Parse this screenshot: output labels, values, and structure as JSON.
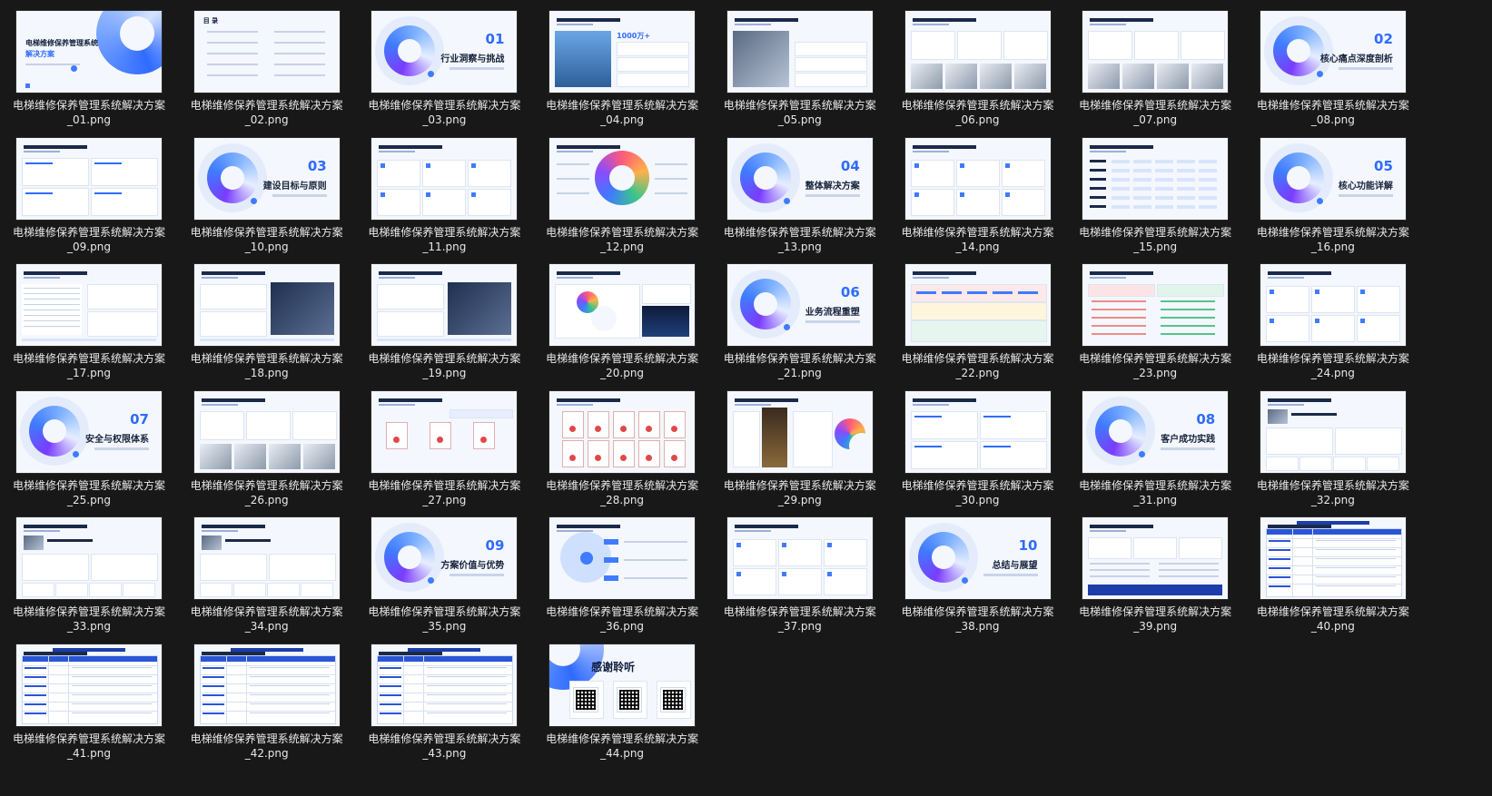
{
  "files": [
    {
      "line1": "电梯维修保养管理系统解决方案",
      "line2": "_01.png",
      "kind": "cover",
      "title": "电梯维修保养管理系统",
      "subtitle": "解决方案"
    },
    {
      "line1": "电梯维修保养管理系统解决方案",
      "line2": "_02.png",
      "kind": "toc",
      "title": "目 录"
    },
    {
      "line1": "电梯维修保养管理系统解决方案",
      "line2": "_03.png",
      "kind": "section",
      "num": "01",
      "title": "行业洞察与挑战"
    },
    {
      "line1": "电梯维修保养管理系统解决方案",
      "line2": "_04.png",
      "kind": "photo-left",
      "num": "1000万+"
    },
    {
      "line1": "电梯维修保养管理系统解决方案",
      "line2": "_05.png",
      "kind": "photo-left"
    },
    {
      "line1": "电梯维修保养管理系统解决方案",
      "line2": "_06.png",
      "kind": "photo-row"
    },
    {
      "line1": "电梯维修保养管理系统解决方案",
      "line2": "_07.png",
      "kind": "photo-row"
    },
    {
      "line1": "电梯维修保养管理系统解决方案",
      "line2": "_08.png",
      "kind": "section",
      "num": "02",
      "title": "核心痛点深度剖析"
    },
    {
      "line1": "电梯维修保养管理系统解决方案",
      "line2": "_09.png",
      "kind": "cards4"
    },
    {
      "line1": "电梯维修保养管理系统解决方案",
      "line2": "_10.png",
      "kind": "section",
      "num": "03",
      "title": "建设目标与原则"
    },
    {
      "line1": "电梯维修保养管理系统解决方案",
      "line2": "_11.png",
      "kind": "cards6"
    },
    {
      "line1": "电梯维修保养管理系统解决方案",
      "line2": "_12.png",
      "kind": "flower"
    },
    {
      "line1": "电梯维修保养管理系统解决方案",
      "line2": "_13.png",
      "kind": "section",
      "num": "04",
      "title": "整体解决方案"
    },
    {
      "line1": "电梯维修保养管理系统解决方案",
      "line2": "_14.png",
      "kind": "cards6"
    },
    {
      "line1": "电梯维修保养管理系统解决方案",
      "line2": "_15.png",
      "kind": "tags"
    },
    {
      "line1": "电梯维修保养管理系统解决方案",
      "line2": "_16.png",
      "kind": "section",
      "num": "05",
      "title": "核心功能详解"
    },
    {
      "line1": "电梯维修保养管理系统解决方案",
      "line2": "_17.png",
      "kind": "screen-left"
    },
    {
      "line1": "电梯维修保养管理系统解决方案",
      "line2": "_18.png",
      "kind": "screen-right"
    },
    {
      "line1": "电梯维修保养管理系统解决方案",
      "line2": "_19.png",
      "kind": "screen-right"
    },
    {
      "line1": "电梯维修保养管理系统解决方案",
      "line2": "_20.png",
      "kind": "dashboard"
    },
    {
      "line1": "电梯维修保养管理系统解决方案",
      "line2": "_21.png",
      "kind": "section",
      "num": "06",
      "title": "业务流程重塑"
    },
    {
      "line1": "电梯维修保养管理系统解决方案",
      "line2": "_22.png",
      "kind": "flow"
    },
    {
      "line1": "电梯维修保养管理系统解决方案",
      "line2": "_23.png",
      "kind": "compare"
    },
    {
      "line1": "电梯维修保养管理系统解决方案",
      "line2": "_24.png",
      "kind": "cards6"
    },
    {
      "line1": "电梯维修保养管理系统解决方案",
      "line2": "_25.png",
      "kind": "section",
      "num": "07",
      "title": "安全与权限体系"
    },
    {
      "line1": "电梯维修保养管理系统解决方案",
      "line2": "_26.png",
      "kind": "photo-row"
    },
    {
      "line1": "电梯维修保养管理系统解决方案",
      "line2": "_27.png",
      "kind": "certs3"
    },
    {
      "line1": "电梯维修保养管理系统解决方案",
      "line2": "_28.png",
      "kind": "certs"
    },
    {
      "line1": "电梯维修保养管理系统解决方案",
      "line2": "_29.png",
      "kind": "phone"
    },
    {
      "line1": "电梯维修保养管理系统解决方案",
      "line2": "_30.png",
      "kind": "cards4"
    },
    {
      "line1": "电梯维修保养管理系统解决方案",
      "line2": "_31.png",
      "kind": "section",
      "num": "08",
      "title": "客户成功实践"
    },
    {
      "line1": "电梯维修保养管理系统解决方案",
      "line2": "_32.png",
      "kind": "case"
    },
    {
      "line1": "电梯维修保养管理系统解决方案",
      "line2": "_33.png",
      "kind": "case"
    },
    {
      "line1": "电梯维修保养管理系统解决方案",
      "line2": "_34.png",
      "kind": "case"
    },
    {
      "line1": "电梯维修保养管理系统解决方案",
      "line2": "_35.png",
      "kind": "section",
      "num": "09",
      "title": "方案价值与优势"
    },
    {
      "line1": "电梯维修保养管理系统解决方案",
      "line2": "_36.png",
      "kind": "circle"
    },
    {
      "line1": "电梯维修保养管理系统解决方案",
      "line2": "_37.png",
      "kind": "cards6"
    },
    {
      "line1": "电梯维修保养管理系统解决方案",
      "line2": "_38.png",
      "kind": "section",
      "num": "10",
      "title": "总结与展望"
    },
    {
      "line1": "电梯维修保养管理系统解决方案",
      "line2": "_39.png",
      "kind": "summary"
    },
    {
      "line1": "电梯维修保养管理系统解决方案",
      "line2": "_40.png",
      "kind": "table"
    },
    {
      "line1": "电梯维修保养管理系统解决方案",
      "line2": "_41.png",
      "kind": "table"
    },
    {
      "line1": "电梯维修保养管理系统解决方案",
      "line2": "_42.png",
      "kind": "table"
    },
    {
      "line1": "电梯维修保养管理系统解决方案",
      "line2": "_43.png",
      "kind": "table"
    },
    {
      "line1": "电梯维修保养管理系统解决方案",
      "line2": "_44.png",
      "kind": "thanks",
      "title": "感谢聆听"
    }
  ],
  "colors": {
    "background": "#181818",
    "caption": "#e8e8e8",
    "accent": "#2f6bff",
    "navy": "#0f1d3a"
  }
}
